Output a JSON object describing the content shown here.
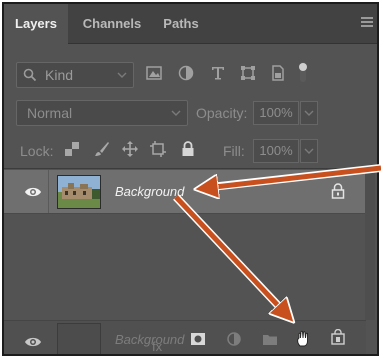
{
  "tabs": [
    {
      "label": "Layers",
      "active": true
    },
    {
      "label": "Channels",
      "active": false
    },
    {
      "label": "Paths",
      "active": false
    }
  ],
  "filter": {
    "kind_label": "Kind"
  },
  "blend": {
    "mode": "Normal",
    "opacity_label": "Opacity:",
    "opacity_value": "100%"
  },
  "lock": {
    "label": "Lock:",
    "fill_label": "Fill:",
    "fill_value": "100%"
  },
  "layer": {
    "name": "Background"
  },
  "ghost": {
    "name": "Background",
    "fx_label": "fx"
  },
  "colors": {
    "panel": "#535353",
    "tab_bar": "#424242",
    "selected_row": "#6f6f6f",
    "arrow": "#c8501e"
  }
}
